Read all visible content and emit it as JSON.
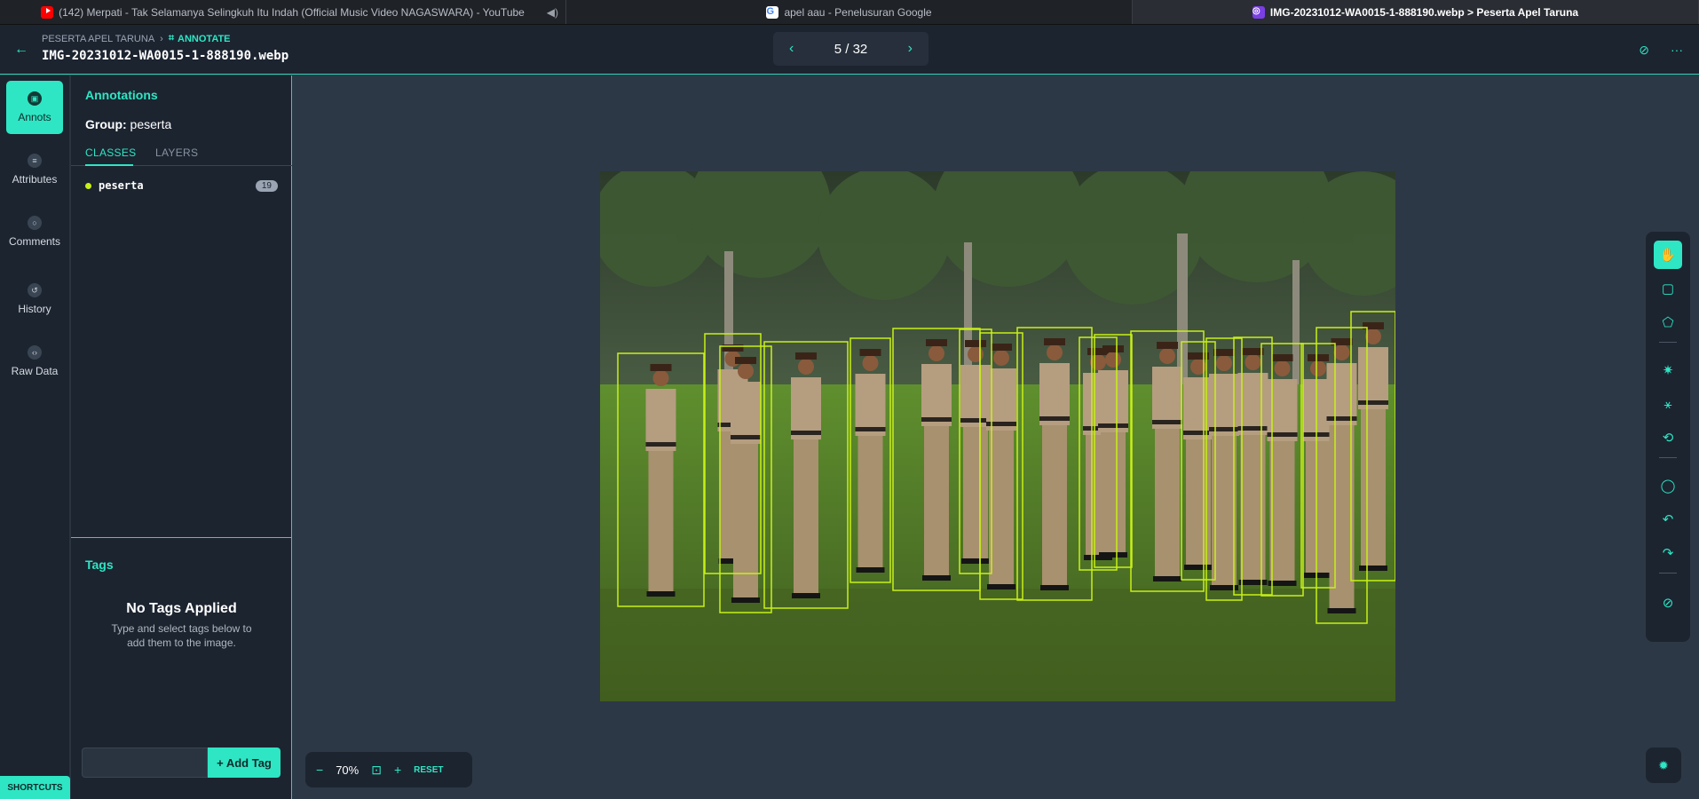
{
  "browser": {
    "tabs": [
      {
        "title": "(142) Merpati - Tak Selamanya Selingkuh Itu Indah (Official Music Video NAGASWARA) - YouTube",
        "icon": "youtube-icon"
      },
      {
        "title": "apel aau - Penelusuran Google",
        "icon": "google-icon"
      },
      {
        "title": "IMG-20231012-WA0015-1-888190.webp > Peserta Apel Taruna",
        "icon": "app-icon"
      }
    ]
  },
  "header": {
    "project": "PESERTA APEL TARUNA",
    "mode": "ANNOTATE",
    "filename": "IMG-20231012-WA0015-1-888190.webp",
    "pager": "5 / 32"
  },
  "rail": {
    "items": [
      {
        "label": "Annots",
        "icon": "annotations-icon"
      },
      {
        "label": "Attributes",
        "icon": "list-icon"
      },
      {
        "label": "Comments",
        "icon": "comment-icon"
      },
      {
        "label": "History",
        "icon": "history-icon"
      },
      {
        "label": "Raw Data",
        "icon": "code-icon"
      }
    ],
    "shortcuts": "SHORTCUTS"
  },
  "panel": {
    "title": "Annotations",
    "group_label": "Group:",
    "group_value": "peserta",
    "tabs": [
      "CLASSES",
      "LAYERS"
    ],
    "classes": [
      {
        "name": "peserta",
        "count": "19",
        "color": "#c8f016"
      }
    ],
    "tags_title": "Tags",
    "no_tags_title": "No Tags Applied",
    "no_tags_line1": "Type and select tags below to",
    "no_tags_line2": "add them to the image.",
    "tag_input_placeholder": "",
    "add_tag": "+ Add Tag"
  },
  "canvas": {
    "zoom": "70%",
    "reset": "RESET",
    "box_color": "#c8f016",
    "accent": "#2ee6c4"
  }
}
